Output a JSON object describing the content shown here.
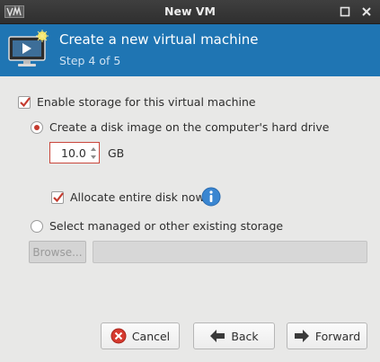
{
  "window": {
    "title": "New VM",
    "app_icon": "virt-manager-logo-icon",
    "controls": [
      "maximize-icon",
      "close-icon"
    ]
  },
  "header": {
    "title": "Create a new virtual machine",
    "step": "Step 4 of 5",
    "icon": "new-vm-monitor-icon",
    "background": "#1f75b3"
  },
  "storage": {
    "enable_label": "Enable storage for this virtual machine",
    "enable_checked": true,
    "create_disk_label": "Create a disk image on the computer's hard drive",
    "create_disk_selected": true,
    "size_value": "10.0",
    "size_unit": "GB",
    "allocate_label": "Allocate entire disk now",
    "allocate_checked": true,
    "info_icon": "info-icon",
    "managed_label": "Select managed or other existing storage",
    "managed_selected": false,
    "browse_label": "Browse...",
    "path_value": ""
  },
  "buttons": {
    "cancel": "Cancel",
    "back": "Back",
    "forward": "Forward"
  },
  "colors": {
    "accent": "#c53b2f",
    "banner": "#1f75b3",
    "info": "#3a86d1"
  }
}
